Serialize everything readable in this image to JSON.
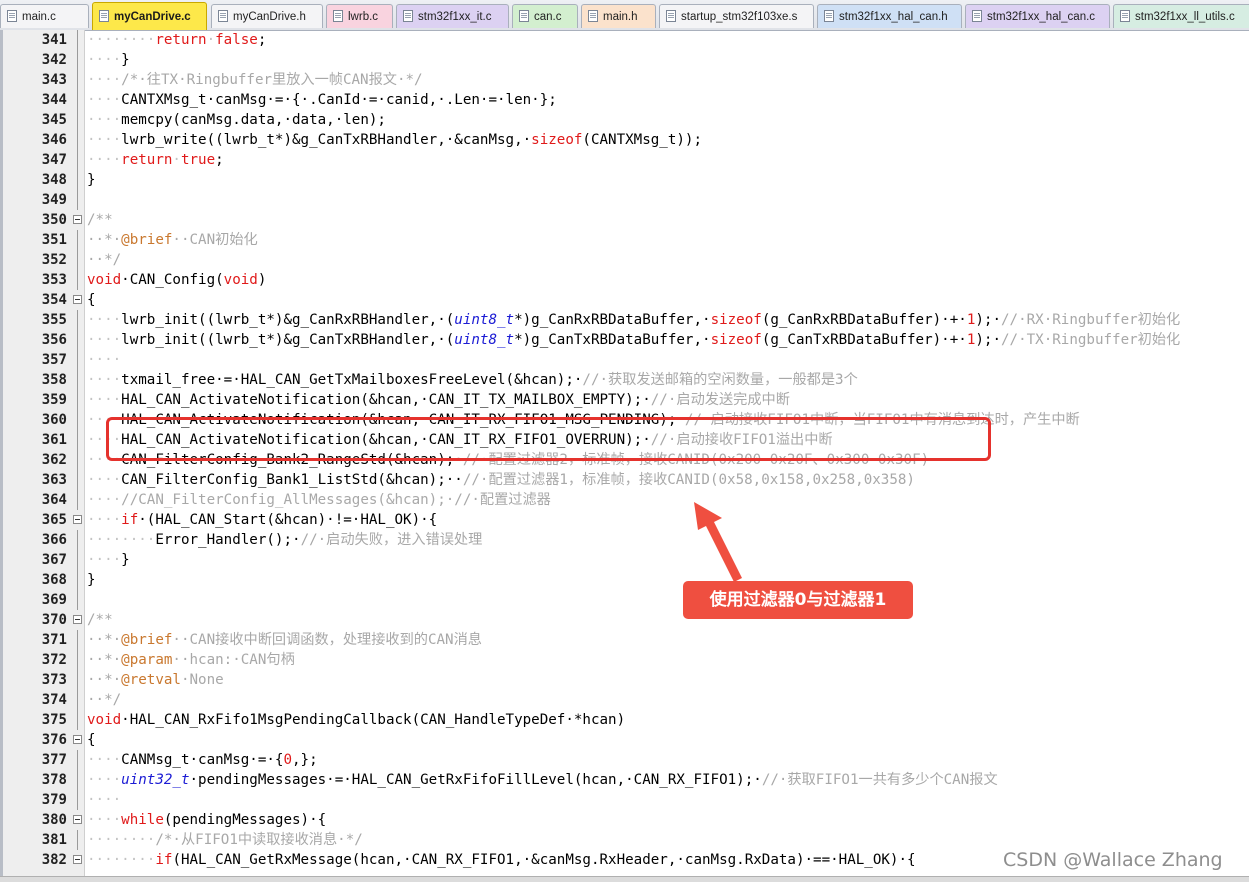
{
  "tabs": [
    {
      "label": "main.c",
      "color": "white",
      "active": false
    },
    {
      "label": "myCanDrive.c",
      "color": "yellow",
      "active": true
    },
    {
      "label": "myCanDrive.h",
      "color": "white",
      "active": false
    },
    {
      "label": "lwrb.c",
      "color": "pink",
      "active": false
    },
    {
      "label": "stm32f1xx_it.c",
      "color": "purple",
      "active": false
    },
    {
      "label": "can.c",
      "color": "green",
      "active": false
    },
    {
      "label": "main.h",
      "color": "peach",
      "active": false
    },
    {
      "label": "startup_stm32f103xe.s",
      "color": "white",
      "active": false
    },
    {
      "label": "stm32f1xx_hal_can.h",
      "color": "blue",
      "active": false
    },
    {
      "label": "stm32f1xx_hal_can.c",
      "color": "purple",
      "active": false
    },
    {
      "label": "stm32f1xx_ll_utils.c",
      "color": "mint",
      "active": false
    }
  ],
  "lines": [
    {
      "n": "341",
      "seg": [
        [
          "ws",
          "········"
        ],
        [
          "kw",
          "return"
        ],
        [
          "ws",
          "·"
        ],
        [
          "kw",
          "false"
        ],
        [
          "tx",
          ";"
        ]
      ]
    },
    {
      "n": "342",
      "seg": [
        [
          "ws",
          "····"
        ],
        [
          "tx",
          "}"
        ]
      ]
    },
    {
      "n": "343",
      "seg": [
        [
          "ws",
          "····"
        ],
        [
          "cm",
          "/*·往TX·Ringbuffer里放入一帧CAN报文·*/"
        ]
      ]
    },
    {
      "n": "344",
      "seg": [
        [
          "ws",
          "····"
        ],
        [
          "tx",
          "CANTXMsg_t·canMsg·=·{·.CanId·=·canid,·.Len·=·len·};"
        ]
      ]
    },
    {
      "n": "345",
      "seg": [
        [
          "ws",
          "····"
        ],
        [
          "tx",
          "memcpy(canMsg.data,·data,·len);"
        ]
      ]
    },
    {
      "n": "346",
      "seg": [
        [
          "ws",
          "····"
        ],
        [
          "tx",
          "lwrb_write((lwrb_t*)&g_CanTxRBHandler,·&canMsg,·"
        ],
        [
          "kw",
          "sizeof"
        ],
        [
          "tx",
          "(CANTXMsg_t));"
        ]
      ]
    },
    {
      "n": "347",
      "seg": [
        [
          "ws",
          "····"
        ],
        [
          "kw",
          "return"
        ],
        [
          "ws",
          "·"
        ],
        [
          "kw",
          "true"
        ],
        [
          "tx",
          ";"
        ]
      ]
    },
    {
      "n": "348",
      "seg": [
        [
          "tx",
          "}"
        ]
      ]
    },
    {
      "n": "349",
      "seg": []
    },
    {
      "n": "350",
      "fold": true,
      "seg": [
        [
          "cm",
          "/**"
        ]
      ]
    },
    {
      "n": "351",
      "seg": [
        [
          "cm",
          "··*·"
        ],
        [
          "dc",
          "@brief"
        ],
        [
          "cm",
          "··CAN初始化"
        ]
      ]
    },
    {
      "n": "352",
      "seg": [
        [
          "cm",
          "··*/"
        ]
      ]
    },
    {
      "n": "353",
      "seg": [
        [
          "kw",
          "void"
        ],
        [
          "tx",
          "·CAN_Config("
        ],
        [
          "kw",
          "void"
        ],
        [
          "tx",
          ")"
        ]
      ]
    },
    {
      "n": "354",
      "fold": true,
      "seg": [
        [
          "tx",
          "{"
        ]
      ]
    },
    {
      "n": "355",
      "seg": [
        [
          "ws",
          "····"
        ],
        [
          "tx",
          "lwrb_init((lwrb_t*)&g_CanRxRBHandler,·("
        ],
        [
          "tp",
          "uint8_t"
        ],
        [
          "tx",
          "*)g_CanRxRBDataBuffer,·"
        ],
        [
          "kw",
          "sizeof"
        ],
        [
          "tx",
          "(g_CanRxRBDataBuffer)·+·"
        ],
        [
          "nm",
          "1"
        ],
        [
          "tx",
          ");·"
        ],
        [
          "cm",
          "//·RX·Ringbuffer初始化"
        ]
      ]
    },
    {
      "n": "356",
      "seg": [
        [
          "ws",
          "····"
        ],
        [
          "tx",
          "lwrb_init((lwrb_t*)&g_CanTxRBHandler,·("
        ],
        [
          "tp",
          "uint8_t"
        ],
        [
          "tx",
          "*)g_CanTxRBDataBuffer,·"
        ],
        [
          "kw",
          "sizeof"
        ],
        [
          "tx",
          "(g_CanTxRBDataBuffer)·+·"
        ],
        [
          "nm",
          "1"
        ],
        [
          "tx",
          ");·"
        ],
        [
          "cm",
          "//·TX·Ringbuffer初始化"
        ]
      ]
    },
    {
      "n": "357",
      "seg": [
        [
          "ws",
          "····"
        ]
      ]
    },
    {
      "n": "358",
      "seg": [
        [
          "ws",
          "····"
        ],
        [
          "tx",
          "txmail_free·=·HAL_CAN_GetTxMailboxesFreeLevel(&hcan);·"
        ],
        [
          "cm",
          "//·获取发送邮箱的空闲数量，一般都是3个"
        ]
      ]
    },
    {
      "n": "359",
      "seg": [
        [
          "ws",
          "····"
        ],
        [
          "tx",
          "HAL_CAN_ActivateNotification(&hcan,·CAN_IT_TX_MAILBOX_EMPTY);·"
        ],
        [
          "cm",
          "//·启动发送完成中断"
        ]
      ]
    },
    {
      "n": "360",
      "seg": [
        [
          "ws",
          "····"
        ],
        [
          "tx",
          "HAL_CAN_ActivateNotification(&hcan,·CAN_IT_RX_FIFO1_MSG_PENDING);·"
        ],
        [
          "cm",
          "//·启动接收FIFO1中断，当FIFO1中有消息到达时，产生中断"
        ]
      ]
    },
    {
      "n": "361",
      "seg": [
        [
          "ws",
          "····"
        ],
        [
          "tx",
          "HAL_CAN_ActivateNotification(&hcan,·CAN_IT_RX_FIFO1_OVERRUN);·"
        ],
        [
          "cm",
          "//·启动接收FIFO1溢出中断"
        ]
      ]
    },
    {
      "n": "362",
      "seg": [
        [
          "ws",
          "····"
        ],
        [
          "tx",
          "CAN_FilterConfig_Bank2_RangeStd(&hcan);·"
        ],
        [
          "cm",
          "//·配置过滤器2，标准帧，接收CANID(0x200~0x20F、0x300~0x30F)"
        ]
      ]
    },
    {
      "n": "363",
      "seg": [
        [
          "ws",
          "····"
        ],
        [
          "tx",
          "CAN_FilterConfig_Bank1_ListStd(&hcan);··"
        ],
        [
          "cm",
          "//·配置过滤器1，标准帧，接收CANID(0x58,0x158,0x258,0x358)"
        ]
      ]
    },
    {
      "n": "364",
      "seg": [
        [
          "ws",
          "····"
        ],
        [
          "cm",
          "//CAN_FilterConfig_AllMessages(&hcan);·//·配置过滤器"
        ]
      ]
    },
    {
      "n": "365",
      "fold": true,
      "seg": [
        [
          "ws",
          "····"
        ],
        [
          "kw",
          "if"
        ],
        [
          "tx",
          "·(HAL_CAN_Start(&hcan)·!=·HAL_OK)·{"
        ]
      ]
    },
    {
      "n": "366",
      "seg": [
        [
          "ws",
          "········"
        ],
        [
          "tx",
          "Error_Handler();·"
        ],
        [
          "cm",
          "//·启动失败，进入错误处理"
        ]
      ]
    },
    {
      "n": "367",
      "seg": [
        [
          "ws",
          "····"
        ],
        [
          "tx",
          "}"
        ]
      ]
    },
    {
      "n": "368",
      "seg": [
        [
          "tx",
          "}"
        ]
      ]
    },
    {
      "n": "369",
      "seg": []
    },
    {
      "n": "370",
      "fold": true,
      "seg": [
        [
          "cm",
          "/**"
        ]
      ]
    },
    {
      "n": "371",
      "seg": [
        [
          "cm",
          "··*·"
        ],
        [
          "dc",
          "@brief"
        ],
        [
          "cm",
          "··CAN接收中断回调函数，处理接收到的CAN消息"
        ]
      ]
    },
    {
      "n": "372",
      "seg": [
        [
          "cm",
          "··*·"
        ],
        [
          "dc",
          "@param"
        ],
        [
          "cm",
          "··hcan:·CAN句柄"
        ]
      ]
    },
    {
      "n": "373",
      "seg": [
        [
          "cm",
          "··*·"
        ],
        [
          "dc",
          "@retval"
        ],
        [
          "cm",
          "·None"
        ]
      ]
    },
    {
      "n": "374",
      "seg": [
        [
          "cm",
          "··*/"
        ]
      ]
    },
    {
      "n": "375",
      "seg": [
        [
          "kw",
          "void"
        ],
        [
          "tx",
          "·HAL_CAN_RxFifo1MsgPendingCallback(CAN_HandleTypeDef·*hcan)"
        ]
      ]
    },
    {
      "n": "376",
      "fold": true,
      "seg": [
        [
          "tx",
          "{"
        ]
      ]
    },
    {
      "n": "377",
      "seg": [
        [
          "ws",
          "····"
        ],
        [
          "tx",
          "CANMsg_t·canMsg·=·{"
        ],
        [
          "nm",
          "0"
        ],
        [
          "tx",
          ",};"
        ]
      ]
    },
    {
      "n": "378",
      "seg": [
        [
          "ws",
          "····"
        ],
        [
          "tp",
          "uint32_t"
        ],
        [
          "tx",
          "·pendingMessages·=·HAL_CAN_GetRxFifoFillLevel(hcan,·CAN_RX_FIFO1);·"
        ],
        [
          "cm",
          "//·获取FIFO1一共有多少个CAN报文"
        ]
      ]
    },
    {
      "n": "379",
      "seg": [
        [
          "ws",
          "····"
        ]
      ]
    },
    {
      "n": "380",
      "fold": true,
      "seg": [
        [
          "ws",
          "····"
        ],
        [
          "kw",
          "while"
        ],
        [
          "tx",
          "(pendingMessages)·{"
        ]
      ]
    },
    {
      "n": "381",
      "seg": [
        [
          "ws",
          "········"
        ],
        [
          "cm",
          "/*·从FIFO1中读取接收消息·*/"
        ]
      ]
    },
    {
      "n": "382",
      "fold": true,
      "seg": [
        [
          "ws",
          "········"
        ],
        [
          "kw",
          "if"
        ],
        [
          "tx",
          "(HAL_CAN_GetRxMessage(hcan,·CAN_RX_FIFO1,·&canMsg.RxHeader,·canMsg.RxData)·==·HAL_OK)·{"
        ]
      ]
    }
  ],
  "annotation": {
    "callout_text": "使用过滤器0与过滤器1"
  },
  "watermark": "CSDN @Wallace Zhang",
  "colors": {
    "keyword": "#e01a1a",
    "type": "#1c1cd4",
    "comment": "#a8a8a8",
    "doc_tag": "#c9782f",
    "active_tab": "#fde84a",
    "highlight": "#e5322d"
  }
}
